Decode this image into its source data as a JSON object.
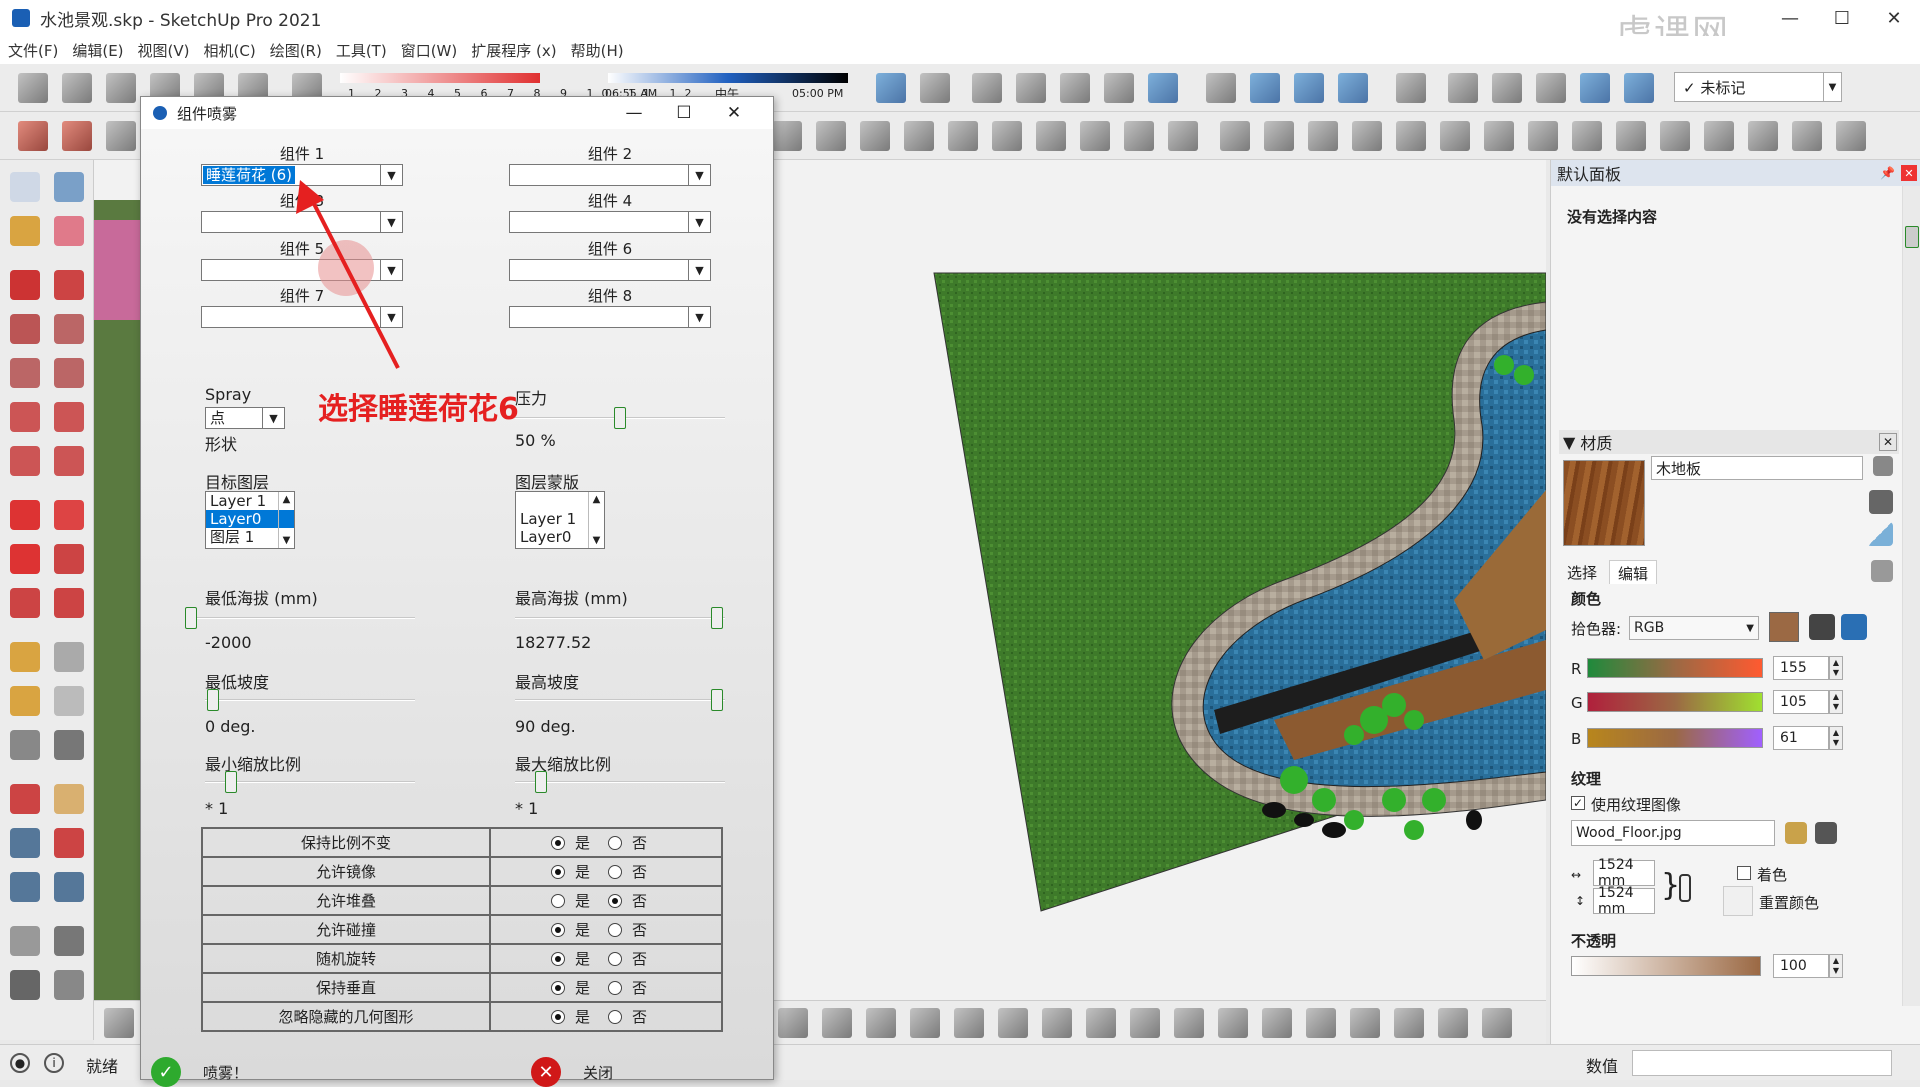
{
  "window": {
    "title": "水池景观.skp - SketchUp Pro 2021",
    "brand": "虎课网"
  },
  "menu": [
    "文件(F)",
    "编辑(E)",
    "视图(V)",
    "相机(C)",
    "绘图(R)",
    "工具(T)",
    "窗口(W)",
    "扩展程序 (x)",
    "帮助(H)"
  ],
  "timeline": {
    "months": "1 2 3 4 5 6 7 8 9 10 11 12",
    "time_start": "06:55 AM",
    "noon": "中午",
    "time_end": "05:00 PM"
  },
  "tag_select": {
    "value": "✓ 未标记"
  },
  "dialog": {
    "title": "组件喷雾",
    "components": [
      {
        "label": "组件 1",
        "value": "睡莲荷花 (6)"
      },
      {
        "label": "组件 2",
        "value": ""
      },
      {
        "label": "组件 3",
        "value": ""
      },
      {
        "label": "组件 4",
        "value": ""
      },
      {
        "label": "组件 5",
        "value": ""
      },
      {
        "label": "组件 6",
        "value": ""
      },
      {
        "label": "组件 7",
        "value": ""
      },
      {
        "label": "组件 8",
        "value": ""
      }
    ],
    "spray_label": "Spray",
    "spray_shape_value": "点",
    "shape_label": "形状",
    "pressure_label": "压力",
    "pressure_value": "50 %",
    "pressure_fraction": 0.5,
    "target_layer_label": "目标图层",
    "target_layers": [
      "Layer 1",
      "Layer0",
      "图层 1"
    ],
    "target_layer_selected": "Layer0",
    "layer_mask_label": "图层蒙版",
    "layer_mask_items": [
      "Layer 1",
      "Layer0"
    ],
    "min_alt_label": "最低海拔 (mm)",
    "min_alt_value": "-2000",
    "max_alt_label": "最高海拔 (mm)",
    "max_alt_value": "18277.52",
    "min_slope_label": "最低坡度",
    "min_slope_value": "0 deg.",
    "max_slope_label": "最高坡度",
    "max_slope_value": "90 deg.",
    "min_scale_label": "最小缩放比例",
    "min_scale_value": "* 1",
    "max_scale_label": "最大缩放比例",
    "max_scale_value": "* 1",
    "options": [
      {
        "label": "保持比例不变",
        "yes": true
      },
      {
        "label": "允许镜像",
        "yes": true
      },
      {
        "label": "允许堆叠",
        "yes": false
      },
      {
        "label": "允许碰撞",
        "yes": true
      },
      {
        "label": "随机旋转",
        "yes": true
      },
      {
        "label": "保持垂直",
        "yes": true
      },
      {
        "label": "忽略隐藏的几何图形",
        "yes": true
      }
    ],
    "yes_label": "是",
    "no_label": "否",
    "spray_button": "喷雾！",
    "close_button": "关闭"
  },
  "annotation": "选择睡莲荷花6",
  "right_panel": {
    "title": "默认面板",
    "entity_info": "没有选择内容",
    "materials_title": "材质",
    "material_name": "木地板",
    "tabs": [
      "选择",
      "编辑"
    ],
    "color_section": "颜色",
    "picker_label": "拾色器:",
    "picker_value": "RGB",
    "swatch_color": "#9b6944",
    "r_label": "R",
    "r_value": "155",
    "g_label": "G",
    "g_value": "105",
    "b_label": "B",
    "b_value": "61",
    "texture_section": "纹理",
    "use_texture_label": "使用纹理图像",
    "texture_file": "Wood_Floor.jpg",
    "tex_width": "1524 mm",
    "tex_height": "1524 mm",
    "colorize_label": "着色",
    "reset_color_label": "重置颜色",
    "opacity_section": "不透明",
    "opacity_value": "100"
  },
  "status": {
    "text": "就绪",
    "value_label": "数值"
  }
}
